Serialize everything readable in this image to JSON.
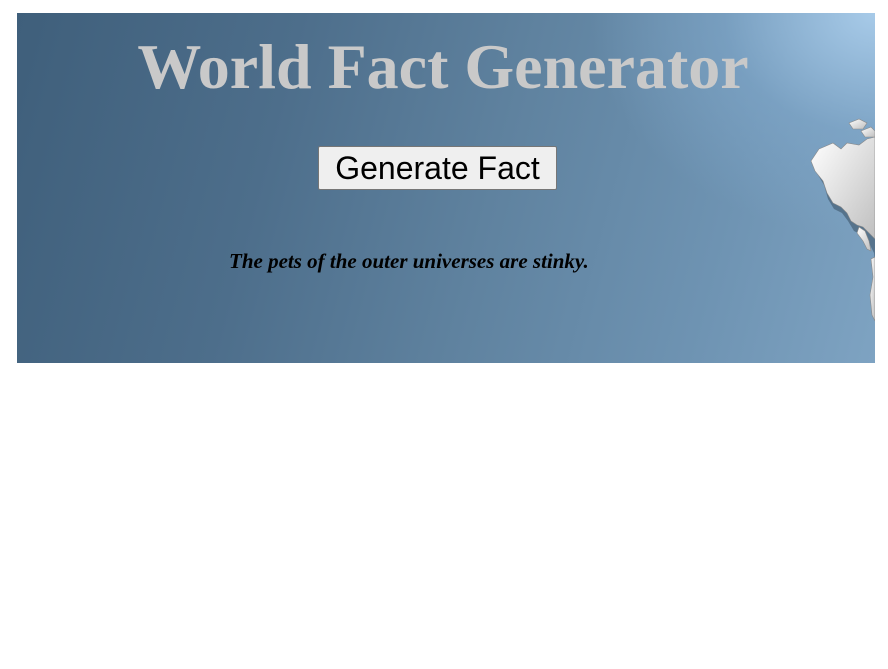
{
  "header": {
    "title": "World Fact Generator"
  },
  "controls": {
    "generate_label": "Generate Fact"
  },
  "fact": {
    "text": "The pets of the outer universes are stinky."
  },
  "decor": {
    "background_icon": "world-map-icon",
    "banner_color_dark": "#3f5f7b",
    "banner_color_light": "#9fc3e2",
    "title_color": "#c9c9c9"
  }
}
